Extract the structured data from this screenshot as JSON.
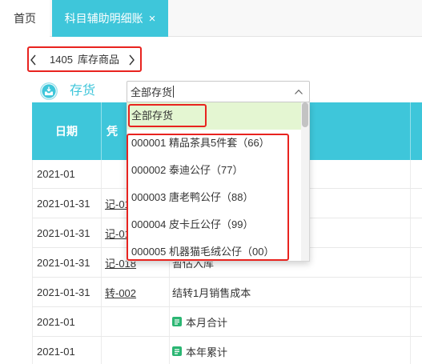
{
  "tabs": [
    {
      "label": "首页"
    },
    {
      "label": "科目辅助明细账",
      "close": "×"
    }
  ],
  "account_nav": {
    "code": "1405",
    "name": "库存商品",
    "prev_icon": "chevron-left-icon",
    "next_icon": "chevron-right-icon"
  },
  "filter": {
    "icon": "inventory-icon",
    "label": "存货",
    "value": "全部存货",
    "toggle_icon": "chevron-up-icon"
  },
  "dropdown": {
    "highlighted_index": 0,
    "options": [
      "全部存货",
      "000001 精品茶具5件套（66）",
      "000002 泰迪公仔（77）",
      "000003 唐老鸭公仔（88）",
      "000004 皮卡丘公仔（99）",
      "000005 机器猫毛绒公仔（00）"
    ]
  },
  "table": {
    "headers": {
      "date": "日期",
      "voucher": "凭"
    },
    "rows": [
      {
        "date": "2021-01",
        "voucher": "",
        "summary": ""
      },
      {
        "date": "2021-01-31",
        "voucher": "记-01",
        "summary": ""
      },
      {
        "date": "2021-01-31",
        "voucher": "记-01",
        "summary": ""
      },
      {
        "date": "2021-01-31",
        "voucher": "记-018",
        "summary": "暂估入库"
      },
      {
        "date": "2021-01-31",
        "voucher": "转-002",
        "summary": "结转1月销售成本"
      },
      {
        "date": "2021-01",
        "voucher": "",
        "summary": "本月合计",
        "icon": "summary-icon"
      },
      {
        "date": "2021-01",
        "voucher": "",
        "summary": "本年累计",
        "icon": "summary-icon"
      }
    ]
  },
  "colors": {
    "accent": "#3ec6da",
    "option_highlight": "#e4f6d2",
    "annotation_box": "#e8231f",
    "summary_icon": "#2bb673"
  }
}
